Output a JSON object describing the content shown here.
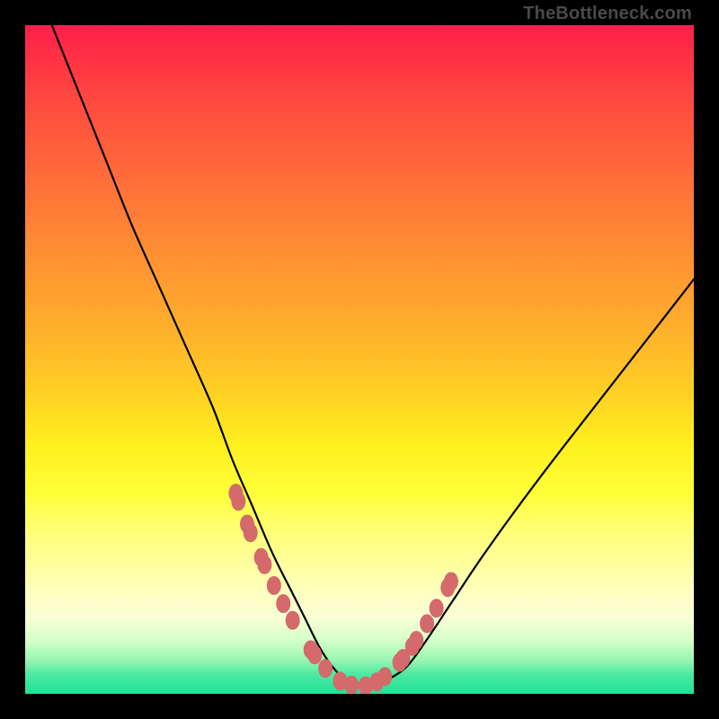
{
  "attribution": "TheBottleneck.com",
  "chart_data": {
    "type": "line",
    "title": "",
    "xlabel": "",
    "ylabel": "",
    "xlim": [
      0,
      100
    ],
    "ylim": [
      0,
      100
    ],
    "series": [
      {
        "name": "bottleneck-curve",
        "x": [
          4,
          8,
          12,
          16,
          20,
          24,
          28,
          31,
          34,
          37,
          40,
          42,
          44,
          46,
          48,
          50,
          52,
          54,
          57,
          60,
          64,
          68,
          73,
          79,
          86,
          93,
          100
        ],
        "y": [
          100,
          90,
          80,
          70,
          61,
          52,
          43,
          35,
          28,
          21,
          15,
          11,
          7,
          4,
          2,
          1,
          1,
          2,
          4,
          8,
          14,
          20,
          27,
          35,
          44,
          53,
          62
        ]
      }
    ],
    "markers": {
      "name": "highlighted-points",
      "x": [
        31.5,
        31.9,
        33.2,
        33.7,
        35.3,
        35.8,
        37.2,
        38.6,
        40.0,
        42.7,
        43.3,
        44.9,
        47.1,
        48.8,
        50.9,
        52.6,
        53.8,
        56.0,
        56.5,
        57.9,
        58.5,
        60.1,
        61.5,
        63.2,
        63.7
      ],
      "y": [
        30.0,
        28.8,
        25.4,
        24.1,
        20.4,
        19.3,
        16.2,
        13.5,
        11.0,
        6.6,
        5.8,
        3.8,
        1.9,
        1.3,
        1.2,
        1.8,
        2.6,
        4.7,
        5.3,
        7.1,
        8.0,
        10.5,
        12.8,
        15.9,
        16.8
      ]
    },
    "background_gradient": {
      "top_color": "#ff1f4a",
      "mid_color": "#ffd024",
      "bottom_color": "#1fe196"
    }
  }
}
